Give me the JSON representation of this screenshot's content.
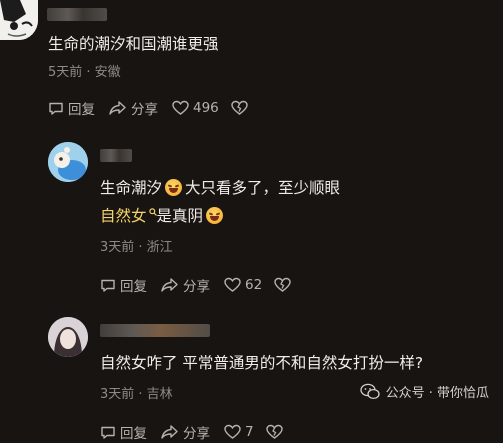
{
  "comments": [
    {
      "text": "生命的潮汐和国潮谁更强",
      "meta": "5天前 · 安徽",
      "reply_label": "回复",
      "share_label": "分享",
      "likes": "496"
    },
    {
      "line1_a": "生命潮汐",
      "line1_b": "大只看多了，至少顺眼",
      "line2_link": "自然女",
      "line2_b": "是真阴",
      "meta": "3天前 · 浙江",
      "reply_label": "回复",
      "share_label": "分享",
      "likes": "62"
    },
    {
      "text": "自然女咋了 平常普通男的不和自然女打扮一样?",
      "meta": "3天前 · 吉林",
      "reply_label": "回复",
      "share_label": "分享",
      "likes": "7"
    }
  ],
  "watermark": {
    "label": "公众号 · 带你恰瓜"
  },
  "icons": {
    "reply": "chat-bubble-icon",
    "share": "share-arrow-icon",
    "like": "heart-icon",
    "dislike": "broken-heart-icon",
    "link_search": "search-icon",
    "emoji": "laughing-tears-emoji",
    "watermark": "wechat-icon"
  }
}
